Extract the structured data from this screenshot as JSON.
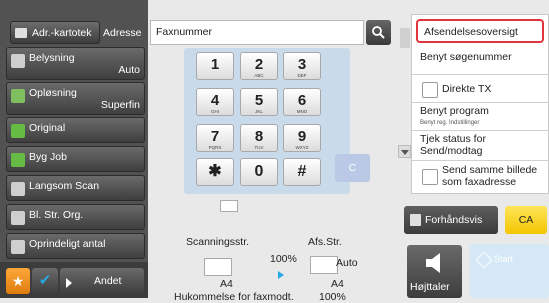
{
  "topbar": {
    "address_book_button": "Adr.-kartotek",
    "address_label": "Adresse",
    "fax_field_value": "Faxnummer"
  },
  "left_menu": [
    {
      "label": "Belysning",
      "value": "Auto"
    },
    {
      "label": "Opløsning",
      "value": "Superfin"
    },
    {
      "label": "Original",
      "value": ""
    },
    {
      "label": "Byg Job",
      "value": ""
    },
    {
      "label": "Langsom Scan",
      "value": ""
    },
    {
      "label": "Bl. Str. Org.",
      "value": ""
    },
    {
      "label": "Oprindeligt antal",
      "value": ""
    }
  ],
  "bottom_left": {
    "other_button": "Andet"
  },
  "keypad": {
    "keys": [
      {
        "digit": "1",
        "letters": ""
      },
      {
        "digit": "2",
        "letters": "ABC"
      },
      {
        "digit": "3",
        "letters": "DEF"
      },
      {
        "digit": "4",
        "letters": "GHI"
      },
      {
        "digit": "5",
        "letters": "JKL"
      },
      {
        "digit": "6",
        "letters": "MNO"
      },
      {
        "digit": "7",
        "letters": "PQRS"
      },
      {
        "digit": "8",
        "letters": "TUV"
      },
      {
        "digit": "9",
        "letters": "WXYZ"
      },
      {
        "digit": "✱",
        "letters": ""
      },
      {
        "digit": "0",
        "letters": ""
      },
      {
        "digit": "#",
        "letters": ""
      }
    ],
    "clear_key": "C"
  },
  "scan_info": {
    "scan_size_label": "Scanningsstr.",
    "scan_percent": "100%",
    "scan_paper": "A4",
    "send_size_label": "Afs.Str.",
    "send_mode": "Auto",
    "send_paper": "A4",
    "memory_label": "Hukommelse for faxmodt.",
    "memory_value": "100%"
  },
  "right_panel": {
    "items": [
      "Afsendelsesoversigt",
      "Benyt søgenummer",
      "Direkte TX",
      "Benyt program",
      "Benyt reg. Indstillinger",
      "Tjek status for Send/modtag",
      "Send samme billede som faxadresse"
    ]
  },
  "actions": {
    "preview_button": "Forhåndsvis",
    "ca_button": "CA",
    "speaker_label": "Højttaler",
    "start_label": "Start"
  },
  "colors": {
    "highlight_border": "#e0343e",
    "ca_yellow": "#f6d21a",
    "keypad_bg": "#c9dbeb"
  }
}
